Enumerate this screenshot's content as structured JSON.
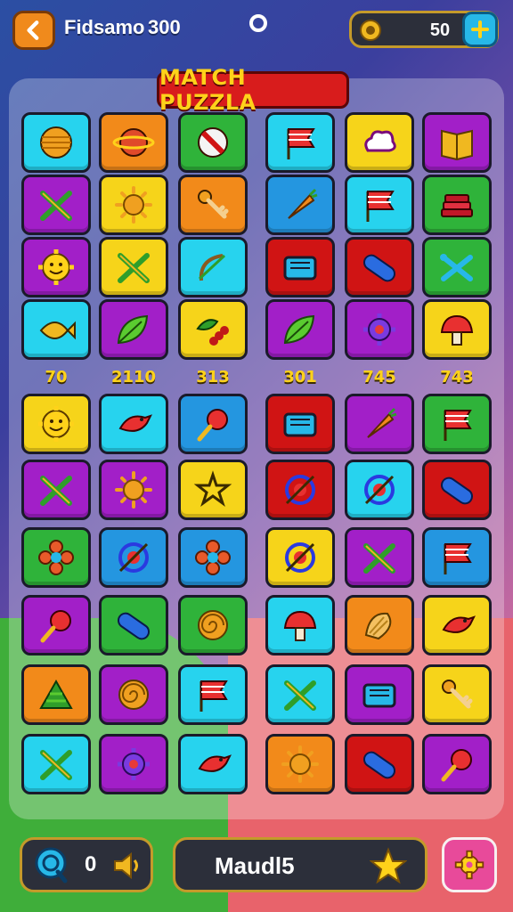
{
  "header": {
    "player_name": "Fidsamo",
    "player_score": "300",
    "coins": "50"
  },
  "title": "MATCH PUZZLA",
  "column_labels": [
    "70",
    "2110",
    "313",
    "301",
    "745",
    "743"
  ],
  "colors": {
    "cyan": "#27d3ee",
    "orange": "#f28a1a",
    "green": "#2fb33a",
    "purple": "#a21fc8",
    "yellow": "#f6d41a",
    "blue": "#2496e0",
    "red": "#d01414",
    "accent_gold": "#ffd21a"
  },
  "grid": [
    [
      {
        "bg": "cyan",
        "icon": "striped-ball-icon"
      },
      {
        "bg": "orange",
        "icon": "planet-icon"
      },
      {
        "bg": "green",
        "icon": "compass-icon"
      },
      {
        "bg": "cyan",
        "icon": "flag-icon"
      },
      {
        "bg": "yellow",
        "icon": "cloud-icon"
      },
      {
        "bg": "purple",
        "icon": "book-icon"
      }
    ],
    [
      {
        "bg": "purple",
        "icon": "crossed-sticks-icon"
      },
      {
        "bg": "yellow",
        "icon": "sun-icon"
      },
      {
        "bg": "orange",
        "icon": "key-icon"
      },
      {
        "bg": "blue",
        "icon": "carrot-icon"
      },
      {
        "bg": "cyan",
        "icon": "flag-icon"
      },
      {
        "bg": "green",
        "icon": "stack-icon"
      }
    ],
    [
      {
        "bg": "purple",
        "icon": "smiley-gear-icon"
      },
      {
        "bg": "yellow",
        "icon": "crossed-sticks-icon"
      },
      {
        "bg": "cyan",
        "icon": "bow-icon"
      },
      {
        "bg": "red",
        "icon": "box-icon"
      },
      {
        "bg": "red",
        "icon": "capsule-icon"
      },
      {
        "bg": "green",
        "icon": "wrench-icon"
      }
    ],
    [
      {
        "bg": "cyan",
        "icon": "fish-icon"
      },
      {
        "bg": "purple",
        "icon": "leaf-icon"
      },
      {
        "bg": "yellow",
        "icon": "berries-icon"
      },
      {
        "bg": "purple",
        "icon": "leaf-icon"
      },
      {
        "bg": "purple",
        "icon": "gear-icon"
      },
      {
        "bg": "yellow",
        "icon": "mushroom-icon"
      }
    ],
    [
      {
        "bg": "yellow",
        "icon": "smiley-gear-icon"
      },
      {
        "bg": "cyan",
        "icon": "bird-icon"
      },
      {
        "bg": "blue",
        "icon": "paddle-icon"
      },
      {
        "bg": "red",
        "icon": "box-icon"
      },
      {
        "bg": "purple",
        "icon": "carrot-icon"
      },
      {
        "bg": "green",
        "icon": "flag-icon"
      }
    ],
    [
      {
        "bg": "purple",
        "icon": "crossed-sticks-icon"
      },
      {
        "bg": "purple",
        "icon": "sun-icon"
      },
      {
        "bg": "yellow",
        "icon": "star-icon"
      },
      {
        "bg": "red",
        "icon": "target-icon"
      },
      {
        "bg": "cyan",
        "icon": "target-icon"
      },
      {
        "bg": "red",
        "icon": "capsule-icon"
      }
    ],
    [
      {
        "bg": "green",
        "icon": "flower-icon"
      },
      {
        "bg": "blue",
        "icon": "target-icon"
      },
      {
        "bg": "blue",
        "icon": "flower-icon"
      },
      {
        "bg": "yellow",
        "icon": "target-icon"
      },
      {
        "bg": "purple",
        "icon": "crossed-sticks-icon"
      },
      {
        "bg": "blue",
        "icon": "flag-icon"
      }
    ],
    [
      {
        "bg": "purple",
        "icon": "paddle-icon"
      },
      {
        "bg": "green",
        "icon": "capsule-icon"
      },
      {
        "bg": "green",
        "icon": "spiral-icon"
      },
      {
        "bg": "cyan",
        "icon": "mushroom-icon"
      },
      {
        "bg": "orange",
        "icon": "shell-icon"
      },
      {
        "bg": "yellow",
        "icon": "bird-icon"
      }
    ],
    [
      {
        "bg": "orange",
        "icon": "tree-icon"
      },
      {
        "bg": "purple",
        "icon": "spiral-icon"
      },
      {
        "bg": "cyan",
        "icon": "flag-icon"
      },
      {
        "bg": "cyan",
        "icon": "crossed-sticks-icon"
      },
      {
        "bg": "purple",
        "icon": "box-icon"
      },
      {
        "bg": "yellow",
        "icon": "key-icon"
      }
    ],
    [
      {
        "bg": "cyan",
        "icon": "crossed-sticks-icon"
      },
      {
        "bg": "purple",
        "icon": "gear-icon"
      },
      {
        "bg": "cyan",
        "icon": "bird-icon"
      },
      {
        "bg": "orange",
        "icon": "sun-icon"
      },
      {
        "bg": "red",
        "icon": "capsule-icon"
      },
      {
        "bg": "purple",
        "icon": "paddle-icon"
      }
    ]
  ],
  "footer": {
    "hint_count": "0",
    "level_name": "Maudl5"
  }
}
